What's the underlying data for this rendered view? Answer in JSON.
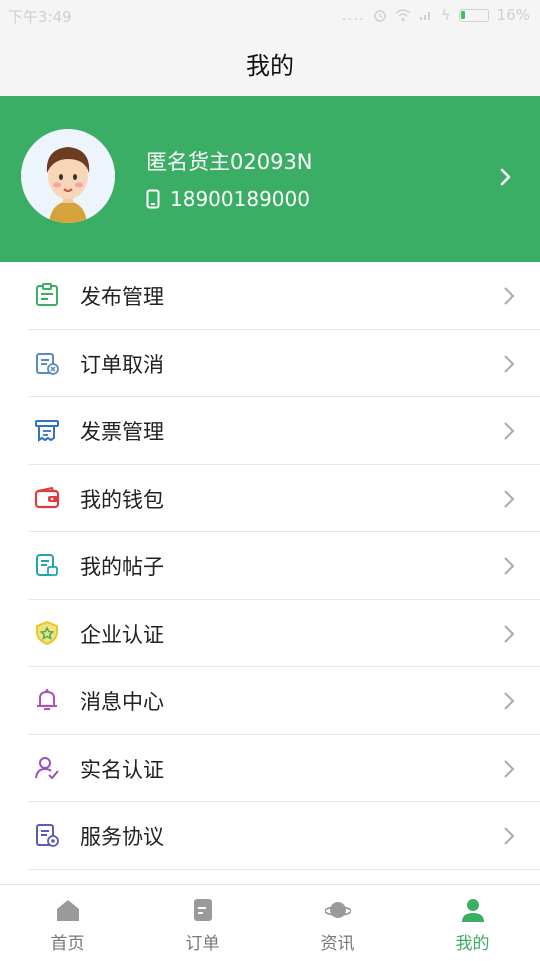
{
  "status_bar": {
    "time": "下午3:49",
    "signal_dots": "....",
    "battery": "16%"
  },
  "header": {
    "title": "我的"
  },
  "profile": {
    "name": "匿名货主02093N",
    "phone": "18900189000"
  },
  "menu": {
    "items": [
      {
        "label": "发布管理",
        "icon": "clipboard-icon",
        "color": "#3aae65"
      },
      {
        "label": "订单取消",
        "icon": "order-cancel-icon",
        "color": "#5a8bc0"
      },
      {
        "label": "发票管理",
        "icon": "invoice-icon",
        "color": "#2f73c9"
      },
      {
        "label": "我的钱包",
        "icon": "wallet-icon",
        "color": "#e03b3b"
      },
      {
        "label": "我的帖子",
        "icon": "post-icon",
        "color": "#20a3b5"
      },
      {
        "label": "企业认证",
        "icon": "shield-badge-icon",
        "color": "#e6c51e"
      },
      {
        "label": "消息中心",
        "icon": "bell-icon",
        "color": "#b14fc0"
      },
      {
        "label": "实名认证",
        "icon": "user-verify-icon",
        "color": "#9c4fc0"
      },
      {
        "label": "服务协议",
        "icon": "agreement-icon",
        "color": "#5b5bb8"
      }
    ]
  },
  "bottom_nav": {
    "items": [
      {
        "label": "首页",
        "icon": "home-icon"
      },
      {
        "label": "订单",
        "icon": "order-icon"
      },
      {
        "label": "资讯",
        "icon": "planet-icon"
      },
      {
        "label": "我的",
        "icon": "person-icon",
        "active": true
      }
    ]
  },
  "colors": {
    "accent": "#3aae65",
    "header_bg": "#f5f5f5"
  }
}
